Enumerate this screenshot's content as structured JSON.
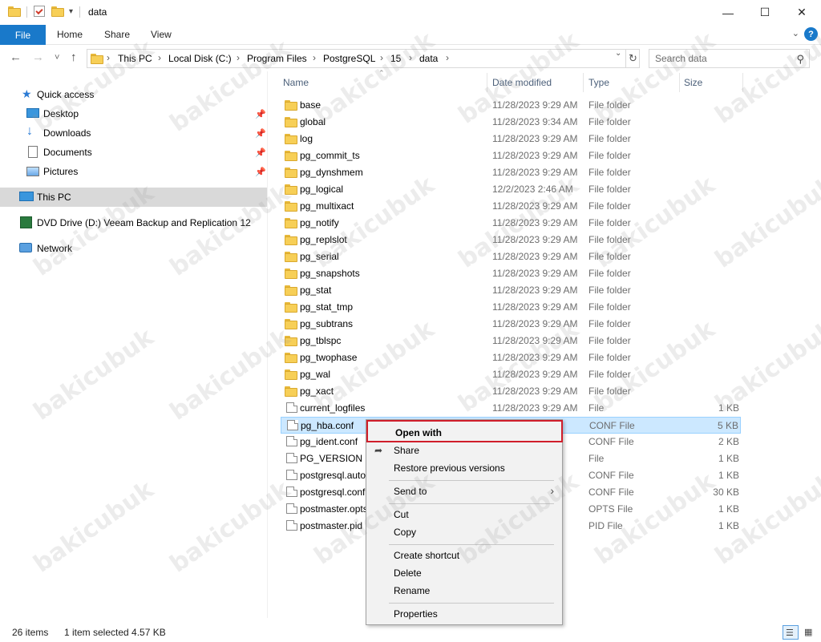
{
  "window": {
    "title": "data",
    "minimize": "—",
    "maximize": "☐",
    "close": "✕",
    "icons": [
      "folder-icon",
      "properties-icon",
      "new-folder-icon",
      "customize-dropdown-icon"
    ]
  },
  "ribbon": {
    "file": "File",
    "tabs": [
      "Home",
      "Share",
      "View"
    ],
    "help": "?"
  },
  "address": {
    "back": "←",
    "forward": "→",
    "recent": "˅",
    "up": "↑",
    "breadcrumbs": [
      "This PC",
      "Local Disk (C:)",
      "Program Files",
      "PostgreSQL",
      "15",
      "data"
    ],
    "search_placeholder": "Search data"
  },
  "nav": {
    "quick_access": "Quick access",
    "items": [
      {
        "label": "Desktop",
        "pinned": true
      },
      {
        "label": "Downloads",
        "pinned": true
      },
      {
        "label": "Documents",
        "pinned": true
      },
      {
        "label": "Pictures",
        "pinned": true
      }
    ],
    "this_pc": "This PC",
    "dvd": "DVD Drive (D:) Veeam Backup and Replication 12",
    "network": "Network"
  },
  "columns": {
    "name": "Name",
    "date": "Date modified",
    "type": "Type",
    "size": "Size"
  },
  "files": [
    {
      "name": "base",
      "date": "11/28/2023 9:29 AM",
      "type": "File folder",
      "size": "",
      "kind": "folder"
    },
    {
      "name": "global",
      "date": "11/28/2023 9:34 AM",
      "type": "File folder",
      "size": "",
      "kind": "folder"
    },
    {
      "name": "log",
      "date": "11/28/2023 9:29 AM",
      "type": "File folder",
      "size": "",
      "kind": "folder"
    },
    {
      "name": "pg_commit_ts",
      "date": "11/28/2023 9:29 AM",
      "type": "File folder",
      "size": "",
      "kind": "folder"
    },
    {
      "name": "pg_dynshmem",
      "date": "11/28/2023 9:29 AM",
      "type": "File folder",
      "size": "",
      "kind": "folder"
    },
    {
      "name": "pg_logical",
      "date": "12/2/2023 2:46 AM",
      "type": "File folder",
      "size": "",
      "kind": "folder"
    },
    {
      "name": "pg_multixact",
      "date": "11/28/2023 9:29 AM",
      "type": "File folder",
      "size": "",
      "kind": "folder"
    },
    {
      "name": "pg_notify",
      "date": "11/28/2023 9:29 AM",
      "type": "File folder",
      "size": "",
      "kind": "folder"
    },
    {
      "name": "pg_replslot",
      "date": "11/28/2023 9:29 AM",
      "type": "File folder",
      "size": "",
      "kind": "folder"
    },
    {
      "name": "pg_serial",
      "date": "11/28/2023 9:29 AM",
      "type": "File folder",
      "size": "",
      "kind": "folder"
    },
    {
      "name": "pg_snapshots",
      "date": "11/28/2023 9:29 AM",
      "type": "File folder",
      "size": "",
      "kind": "folder"
    },
    {
      "name": "pg_stat",
      "date": "11/28/2023 9:29 AM",
      "type": "File folder",
      "size": "",
      "kind": "folder"
    },
    {
      "name": "pg_stat_tmp",
      "date": "11/28/2023 9:29 AM",
      "type": "File folder",
      "size": "",
      "kind": "folder"
    },
    {
      "name": "pg_subtrans",
      "date": "11/28/2023 9:29 AM",
      "type": "File folder",
      "size": "",
      "kind": "folder"
    },
    {
      "name": "pg_tblspc",
      "date": "11/28/2023 9:29 AM",
      "type": "File folder",
      "size": "",
      "kind": "folder"
    },
    {
      "name": "pg_twophase",
      "date": "11/28/2023 9:29 AM",
      "type": "File folder",
      "size": "",
      "kind": "folder"
    },
    {
      "name": "pg_wal",
      "date": "11/28/2023 9:29 AM",
      "type": "File folder",
      "size": "",
      "kind": "folder"
    },
    {
      "name": "pg_xact",
      "date": "11/28/2023 9:29 AM",
      "type": "File folder",
      "size": "",
      "kind": "folder"
    },
    {
      "name": "current_logfiles",
      "date": "11/28/2023 9:29 AM",
      "type": "File",
      "size": "1 KB",
      "kind": "file"
    },
    {
      "name": "pg_hba.conf",
      "date": "AM",
      "type": "CONF File",
      "size": "5 KB",
      "kind": "file",
      "selected": true
    },
    {
      "name": "pg_ident.conf",
      "date": "AM",
      "type": "CONF File",
      "size": "2 KB",
      "kind": "file"
    },
    {
      "name": "PG_VERSION",
      "date": "AM",
      "type": "File",
      "size": "1 KB",
      "kind": "file"
    },
    {
      "name": "postgresql.auto",
      "date": "AM",
      "type": "CONF File",
      "size": "1 KB",
      "kind": "file"
    },
    {
      "name": "postgresql.conf",
      "date": "AM",
      "type": "CONF File",
      "size": "30 KB",
      "kind": "file"
    },
    {
      "name": "postmaster.opts",
      "date": "AM",
      "type": "OPTS File",
      "size": "1 KB",
      "kind": "file"
    },
    {
      "name": "postmaster.pid",
      "date": "AM",
      "type": "PID File",
      "size": "1 KB",
      "kind": "file"
    }
  ],
  "context_menu": {
    "open_with": "Open with",
    "share": "Share",
    "restore": "Restore previous versions",
    "send_to": "Send to",
    "cut": "Cut",
    "copy": "Copy",
    "create_shortcut": "Create shortcut",
    "delete": "Delete",
    "rename": "Rename",
    "properties": "Properties",
    "highlight_color": "#d01e2b"
  },
  "status": {
    "count": "26 items",
    "selection": "1 item selected  4.57 KB"
  },
  "watermark": "bakicubuk",
  "colors": {
    "accent": "#1979ca",
    "selection": "#cce8ff",
    "folder": "#f7cf57"
  }
}
